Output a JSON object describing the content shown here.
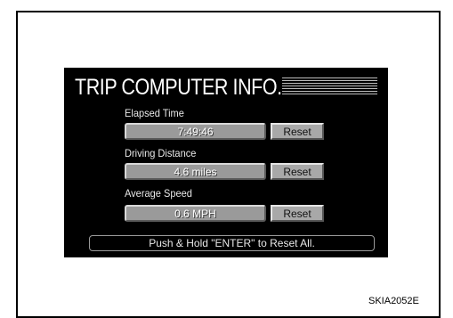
{
  "screen": {
    "title": "TRIP COMPUTER INFO.",
    "rows": [
      {
        "label": "Elapsed Time",
        "value": "7:49:46",
        "button": "Reset"
      },
      {
        "label": "Driving Distance",
        "value": "4.6 miles",
        "button": "Reset"
      },
      {
        "label": "Average Speed",
        "value": "0.6 MPH",
        "button": "Reset"
      }
    ],
    "footer_hint": "Push & Hold \"ENTER\" to Reset All."
  },
  "figure_code": "SKIA2052E"
}
